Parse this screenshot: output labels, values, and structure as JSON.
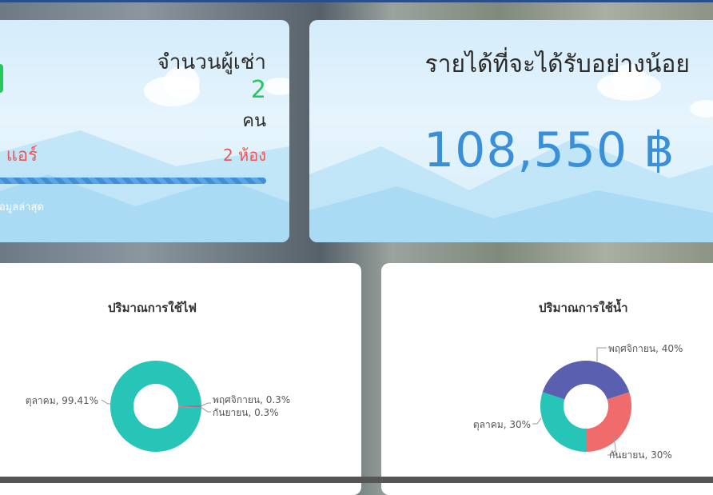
{
  "tenants_card": {
    "title": "จำนวนผู้เช่า",
    "count": "2",
    "unit": "คน",
    "air_label": "ง แอร์",
    "rooms": "2 ห้อง",
    "footer": "ข้อมูลล่าสุด",
    "accent_color": "#24c85b",
    "alert_color": "#e8585a",
    "icon": "document-icon"
  },
  "income_card": {
    "title": "รายได้ที่จะได้รับอย่างน้อย",
    "value": "108,550 ฿",
    "value_color": "#3a8fd8"
  },
  "electric_panel": {
    "title": "ปริมาณการใช้ไฟ",
    "chart_data": {
      "type": "pie",
      "donut": true,
      "categories": [
        "ตุลาคม",
        "พฤศจิกายน",
        "กันยายน"
      ],
      "values": [
        99.41,
        0.3,
        0.3
      ],
      "labels": [
        "ตุลาคม, 99.41%",
        "พฤศจิกายน, 0.3%",
        "กันยายน, 0.3%"
      ],
      "colors": [
        "#27c4b8",
        "#5b5fb0",
        "#f06b6b"
      ]
    }
  },
  "water_panel": {
    "title": "ปริมาณการใช้น้ำ",
    "chart_data": {
      "type": "pie",
      "donut": true,
      "categories": [
        "พฤศจิกายน",
        "กันยายน",
        "ตุลาคม"
      ],
      "values": [
        40,
        30,
        30
      ],
      "labels": [
        "พฤศจิกายน, 40%",
        "กันยายน, 30%",
        "ตุลาคม, 30%"
      ],
      "colors": [
        "#5b5fb0",
        "#f06b6b",
        "#27c4b8"
      ]
    }
  }
}
